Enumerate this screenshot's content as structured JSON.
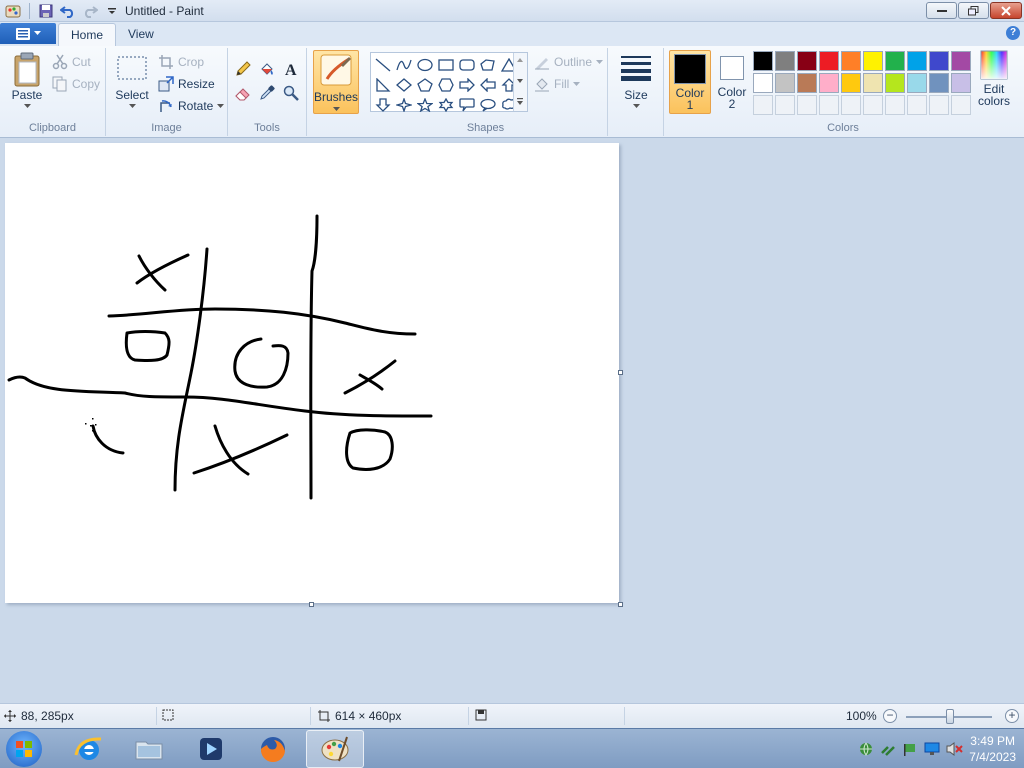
{
  "window": {
    "title": "Untitled - Paint"
  },
  "tabs": [
    {
      "label": "Home"
    },
    {
      "label": "View"
    }
  ],
  "clipboard": {
    "paste": "Paste",
    "cut": "Cut",
    "copy": "Copy",
    "group": "Clipboard"
  },
  "image": {
    "select": "Select",
    "crop": "Crop",
    "resize": "Resize",
    "rotate": "Rotate",
    "group": "Image"
  },
  "tools": {
    "group": "Tools"
  },
  "brushes": {
    "label": "Brushes"
  },
  "shapes": {
    "outline": "Outline",
    "fill": "Fill",
    "group": "Shapes"
  },
  "size": {
    "label": "Size"
  },
  "colors": {
    "color1_line1": "Color",
    "color1_line2": "1",
    "color2_line1": "Color",
    "color2_line2": "2",
    "edit_line1": "Edit",
    "edit_line2": "colors",
    "group": "Colors",
    "color1": "#000000",
    "color2": "#ffffff",
    "palette_row1": [
      "#000000",
      "#7f7f7f",
      "#880015",
      "#ed1c24",
      "#ff7f27",
      "#fff200",
      "#22b14c",
      "#00a2e8",
      "#3f48cc",
      "#a349a4"
    ],
    "palette_row2": [
      "#ffffff",
      "#c3c3c3",
      "#b97a57",
      "#ffaec9",
      "#ffc90e",
      "#efe4b0",
      "#b5e61d",
      "#99d9ea",
      "#7092be",
      "#c8bfe7"
    ]
  },
  "status": {
    "cursor": "88, 285px",
    "canvas_size": "614 × 460px",
    "zoom": "100%"
  },
  "taskbar": {
    "time": "3:49 PM",
    "date": "7/4/2023"
  }
}
